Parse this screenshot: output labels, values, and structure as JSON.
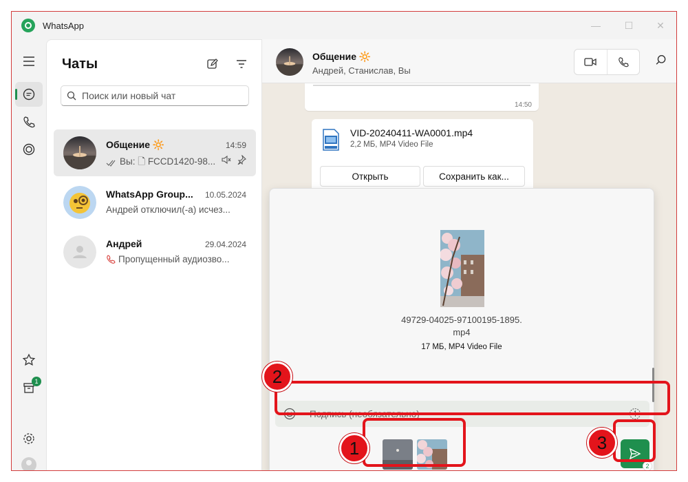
{
  "window": {
    "title": "WhatsApp"
  },
  "colors": {
    "accent": "#1f8f4e",
    "annotation": "#e3141b"
  },
  "rail": {
    "items": [
      {
        "name": "menu-icon"
      },
      {
        "name": "chats-icon",
        "active": true
      },
      {
        "name": "calls-icon"
      },
      {
        "name": "status-icon"
      }
    ],
    "bottom": [
      {
        "name": "starred-icon"
      },
      {
        "name": "archive-icon",
        "badge": "1"
      },
      {
        "name": "settings-icon"
      },
      {
        "name": "profile-avatar"
      }
    ]
  },
  "chatlist": {
    "title": "Чаты",
    "search_placeholder": "Поиск или новый чат",
    "chats": [
      {
        "name": "Общение",
        "emoji": "🔆",
        "time": "14:59",
        "preview": "Вы: 🗋 FCCD1420-98...",
        "muted": true,
        "pinned": true,
        "selected": true
      },
      {
        "name": "WhatsApp Group...",
        "time": "10.05.2024",
        "preview": "Андрей отключил(-а) исчез..."
      },
      {
        "name": "Андрей",
        "time": "29.04.2024",
        "preview": "Пропущенный аудиозво..."
      }
    ]
  },
  "conversation": {
    "name": "Общение",
    "emoji": "🔆",
    "participants": "Андрей, Станислав, Вы",
    "prev_time": "14:50",
    "file_message": {
      "file_name": "VID-20240411-WA0001.mp4",
      "file_meta": "2,2 МБ, MP4 Video File",
      "open_label": "Открыть",
      "save_label": "Сохранить как..."
    }
  },
  "attachment": {
    "file_name": "49729-04025-97100195-1895.\nmp4",
    "file_meta": "17 МБ, MP4 Video File",
    "caption_placeholder": "Подпись (необязательно)",
    "send_count": "2"
  },
  "annotations": {
    "m1": "1",
    "m2": "2",
    "m3": "3"
  }
}
